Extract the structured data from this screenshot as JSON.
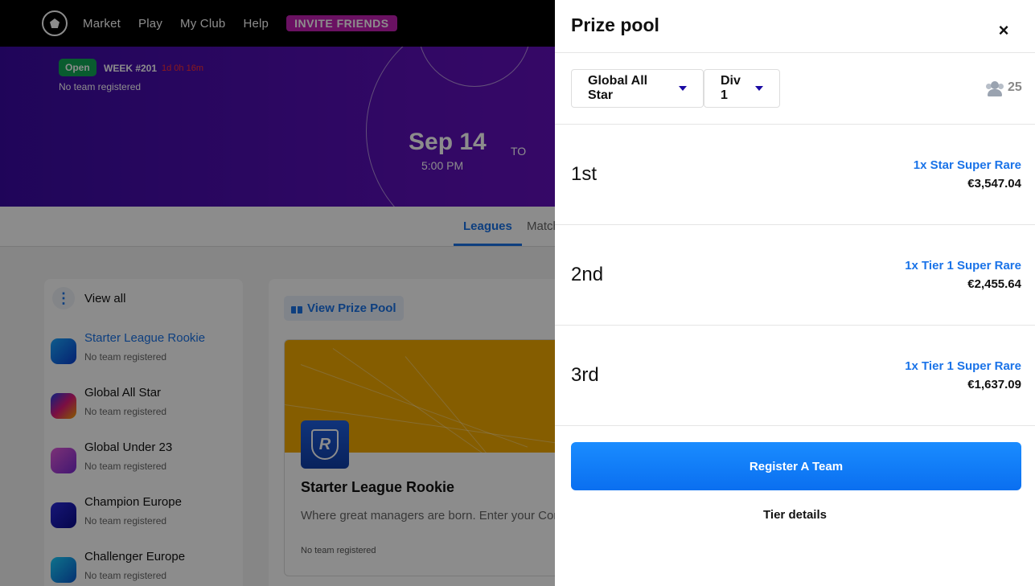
{
  "nav": {
    "logo_icon": "soccer-ball-icon",
    "items": [
      "Market",
      "Play",
      "My Club",
      "Help"
    ],
    "invite_label": "INVITE FRIENDS"
  },
  "hero": {
    "badge": "Open",
    "week": "WEEK #201",
    "countdown": "1d 0h 16m",
    "no_team": "No team registered",
    "date": "Sep 14",
    "time": "5:00 PM",
    "to": "TO"
  },
  "tabs": [
    "Leagues",
    "Match"
  ],
  "sidebar": {
    "view_all": "View all",
    "leagues": [
      {
        "name": "Starter League Rookie",
        "sub": "No team registered",
        "selected": true
      },
      {
        "name": "Global All Star",
        "sub": "No team registered",
        "selected": false
      },
      {
        "name": "Global Under 23",
        "sub": "No team registered",
        "selected": false
      },
      {
        "name": "Champion Europe",
        "sub": "No team registered",
        "selected": false
      },
      {
        "name": "Challenger Europe",
        "sub": "No team registered",
        "selected": false
      }
    ]
  },
  "main": {
    "view_prize_pool": "View Prize Pool",
    "card_title": "Starter League Rookie",
    "card_desc": "Where great managers are born. Enter your Cor",
    "card_status": "No team registered"
  },
  "panel": {
    "title": "Prize pool",
    "close_icon": "close-icon",
    "league_select": "Global All Star",
    "division_select": "Div 1",
    "participants": "25",
    "prizes": [
      {
        "rank": "1st",
        "card": "1x Star Super Rare",
        "amount": "€3,547.04"
      },
      {
        "rank": "2nd",
        "card": "1x Tier 1 Super Rare",
        "amount": "€2,455.64"
      },
      {
        "rank": "3rd",
        "card": "1x Tier 1 Super Rare",
        "amount": "€1,637.09"
      }
    ],
    "register_label": "Register A Team",
    "tier_details_label": "Tier details"
  },
  "colors": {
    "accent": "#1a73e8",
    "invite": "#c21fb3",
    "hero_purple": "#5b0fb8",
    "open_badge": "#12a857",
    "countdown": "#ff3030"
  }
}
